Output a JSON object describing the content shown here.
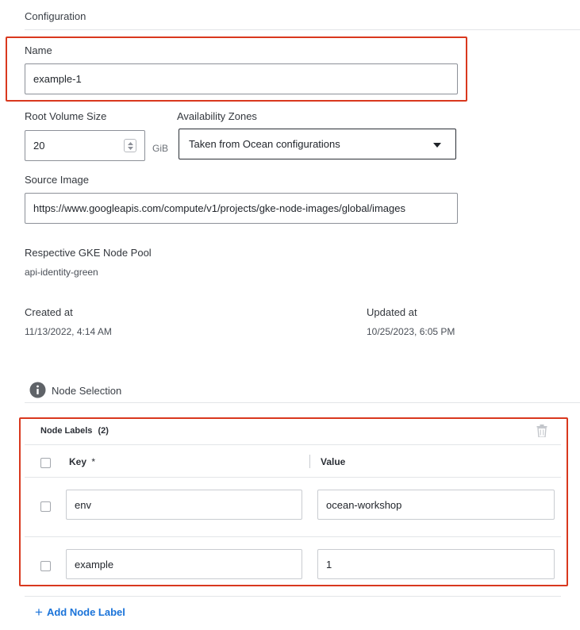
{
  "configuration": {
    "title": "Configuration"
  },
  "name_field": {
    "label": "Name",
    "value": "example-1"
  },
  "root_volume": {
    "label": "Root Volume Size",
    "value": "20",
    "unit": "GiB"
  },
  "availability_zones": {
    "label": "Availability Zones",
    "selected": "Taken from Ocean configurations"
  },
  "source_image": {
    "label": "Source Image",
    "value": "https://www.googleapis.com/compute/v1/projects/gke-node-images/global/images"
  },
  "node_pool": {
    "label": "Respective GKE Node Pool",
    "value": "api-identity-green"
  },
  "created": {
    "label": "Created at",
    "value": "11/13/2022, 4:14 AM"
  },
  "updated": {
    "label": "Updated at",
    "value": "10/25/2023, 6:05 PM"
  },
  "node_selection": {
    "title": "Node Selection"
  },
  "node_labels": {
    "title": "Node Labels",
    "count": "(2)",
    "key_header": "Key",
    "required_mark": "*",
    "value_header": "Value",
    "rows": [
      {
        "key": "env",
        "value": "ocean-workshop"
      },
      {
        "key": "example",
        "value": "1"
      }
    ]
  },
  "add_label": {
    "plus": "+",
    "text": "Add Node Label"
  },
  "colors": {
    "highlight": "#d9381e",
    "link": "#1a73d9"
  }
}
